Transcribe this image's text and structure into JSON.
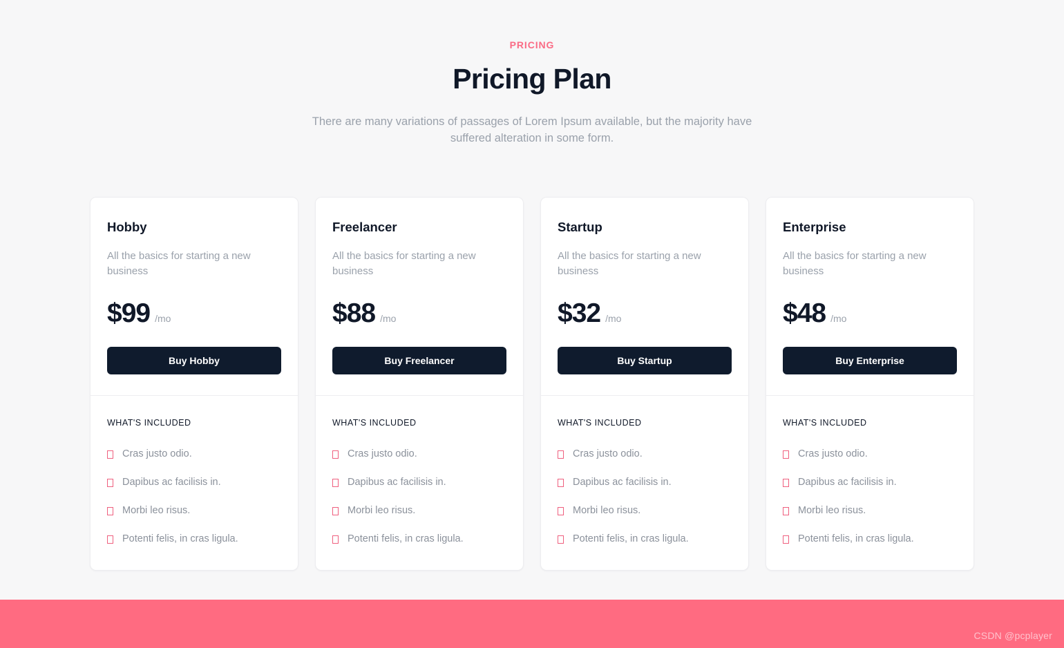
{
  "header": {
    "eyebrow": "PRICING",
    "title": "Pricing Plan",
    "subtitle": "There are many variations of passages of Lorem Ipsum available, but the majority have suffered alteration in some form."
  },
  "theme": {
    "accent_pink": "#fa6b85",
    "band_pink": "#ff6b81",
    "dark_navy": "#0f1b2d",
    "page_background": "#f7f7f8",
    "card_background": "#ffffff",
    "muted_text": "#9aa1ab"
  },
  "plans": [
    {
      "name": "Hobby",
      "description": "All the basics for starting a new business",
      "price": "$99",
      "period": "/mo",
      "buy_label": "Buy Hobby",
      "included_label": "WHAT'S INCLUDED",
      "bullet_icon": "tofu-box-icon",
      "features": [
        "Cras justo odio.",
        "Dapibus ac facilisis in.",
        "Morbi leo risus.",
        "Potenti felis, in cras ligula."
      ]
    },
    {
      "name": "Freelancer",
      "description": "All the basics for starting a new business",
      "price": "$88",
      "period": "/mo",
      "buy_label": "Buy Freelancer",
      "included_label": "WHAT'S INCLUDED",
      "bullet_icon": "tofu-box-icon",
      "features": [
        "Cras justo odio.",
        "Dapibus ac facilisis in.",
        "Morbi leo risus.",
        "Potenti felis, in cras ligula."
      ]
    },
    {
      "name": "Startup",
      "description": "All the basics for starting a new business",
      "price": "$32",
      "period": "/mo",
      "buy_label": "Buy Startup",
      "included_label": "WHAT'S INCLUDED",
      "bullet_icon": "tofu-box-icon",
      "features": [
        "Cras justo odio.",
        "Dapibus ac facilisis in.",
        "Morbi leo risus.",
        "Potenti felis, in cras ligula."
      ]
    },
    {
      "name": "Enterprise",
      "description": "All the basics for starting a new business",
      "price": "$48",
      "period": "/mo",
      "buy_label": "Buy Enterprise",
      "included_label": "WHAT'S INCLUDED",
      "bullet_icon": "tofu-box-icon",
      "features": [
        "Cras justo odio.",
        "Dapibus ac facilisis in.",
        "Morbi leo risus.",
        "Potenti felis, in cras ligula."
      ]
    }
  ],
  "footer": {
    "watermark": "CSDN @pcplayer"
  }
}
